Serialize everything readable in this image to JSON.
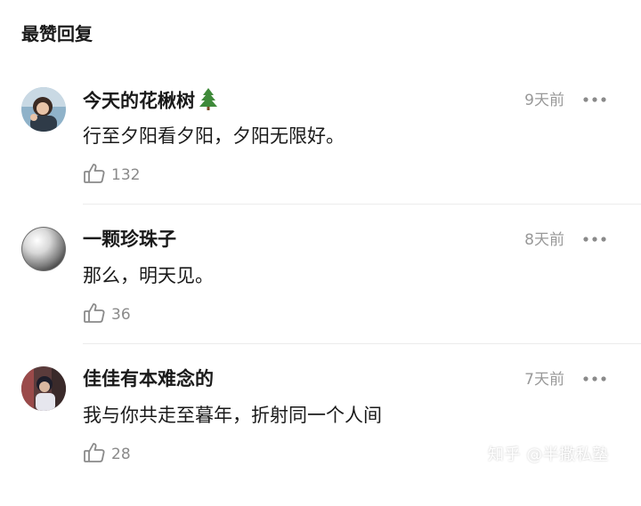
{
  "section": {
    "title": "最赞回复"
  },
  "comments": [
    {
      "username": "今天的花楸树",
      "username_emoji": "evergreen-tree-icon",
      "time": "9天前",
      "content": "行至夕阳看夕阳，夕阳无限好。",
      "likes": "132"
    },
    {
      "username": "一颗珍珠子",
      "time": "8天前",
      "content": "那么，明天见。",
      "likes": "36"
    },
    {
      "username": "佳佳有本难念的",
      "time": "7天前",
      "content": "我与你共走至暮年，折射同一个人间",
      "likes": "28"
    }
  ],
  "watermark": "知乎 @半撒私塾",
  "colors": {
    "text_primary": "#1a1a1a",
    "text_secondary": "#999999",
    "divider": "#ececec",
    "icon": "#8a8a8a"
  }
}
